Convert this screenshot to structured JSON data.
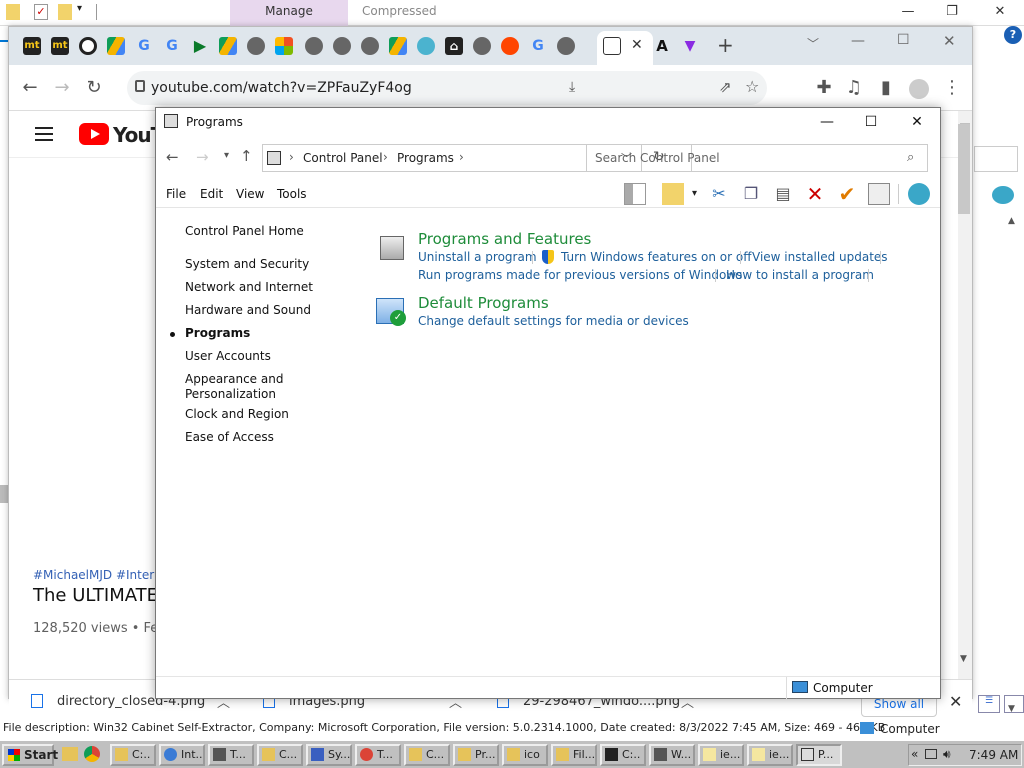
{
  "explorer": {
    "manage_tab": "Manage",
    "compressed_tab": "Compressed",
    "help_icon": "?",
    "right_title": "Computer",
    "list_header_glyphs": [
      "r",
      "1",
      "1"
    ]
  },
  "chrome": {
    "url": "youtube.com/watch?v=ZPFauZyF4og",
    "new_tab": "+",
    "youtube_text": "YouTub",
    "hashtags": "#MichaelMJD #Internet",
    "video_title": "The ULTIMATE I",
    "views": "128,520 views • Feb",
    "downloads": [
      "directory_closed-4.png",
      "images.png",
      "29-298467_windo....png"
    ],
    "show_all": "Show all"
  },
  "control_panel": {
    "title": "Programs",
    "breadcrumb": [
      "Control Panel",
      "Programs"
    ],
    "search_placeholder": "Search Control Panel",
    "menu": [
      "File",
      "Edit",
      "View",
      "Tools"
    ],
    "sidebar": {
      "home": "Control Panel Home",
      "items": [
        "System and Security",
        "Network and Internet",
        "Hardware and Sound",
        "Programs",
        "User Accounts",
        "Appearance and",
        "Personalization",
        "Clock and Region",
        "Ease of Access"
      ]
    },
    "categories": [
      {
        "heading": "Programs and Features",
        "links": [
          "Uninstall a program",
          "Turn Windows features on or off",
          "View installed updates",
          "Run programs made for previous versions of Windows",
          "How to install a program"
        ]
      },
      {
        "heading": "Default Programs",
        "links": [
          "Change default settings for media or devices"
        ]
      }
    ],
    "status": "Computer"
  },
  "statusline": "File description: Win32 Cabinet Self-Extractor, Company: Microsoft Corporation, File version: 5.0.2314.1000, Date created: 8/3/2022 7:45 AM, Size: 469 - 469 KB",
  "taskbar": {
    "start": "Start",
    "buttons": [
      "C:..",
      "Int..",
      "T...",
      "C...",
      "Sy...",
      "T...",
      "C...",
      "Pr...",
      "ico",
      "Fil...",
      "C:..",
      "W...",
      "ie...",
      "ie...",
      "P..."
    ],
    "clock": "7:49 AM",
    "tray_arrow": "«"
  },
  "colors": {
    "link": "#1d5f9b",
    "heading": "#1e8c3a",
    "accent": "#1a73e8"
  }
}
